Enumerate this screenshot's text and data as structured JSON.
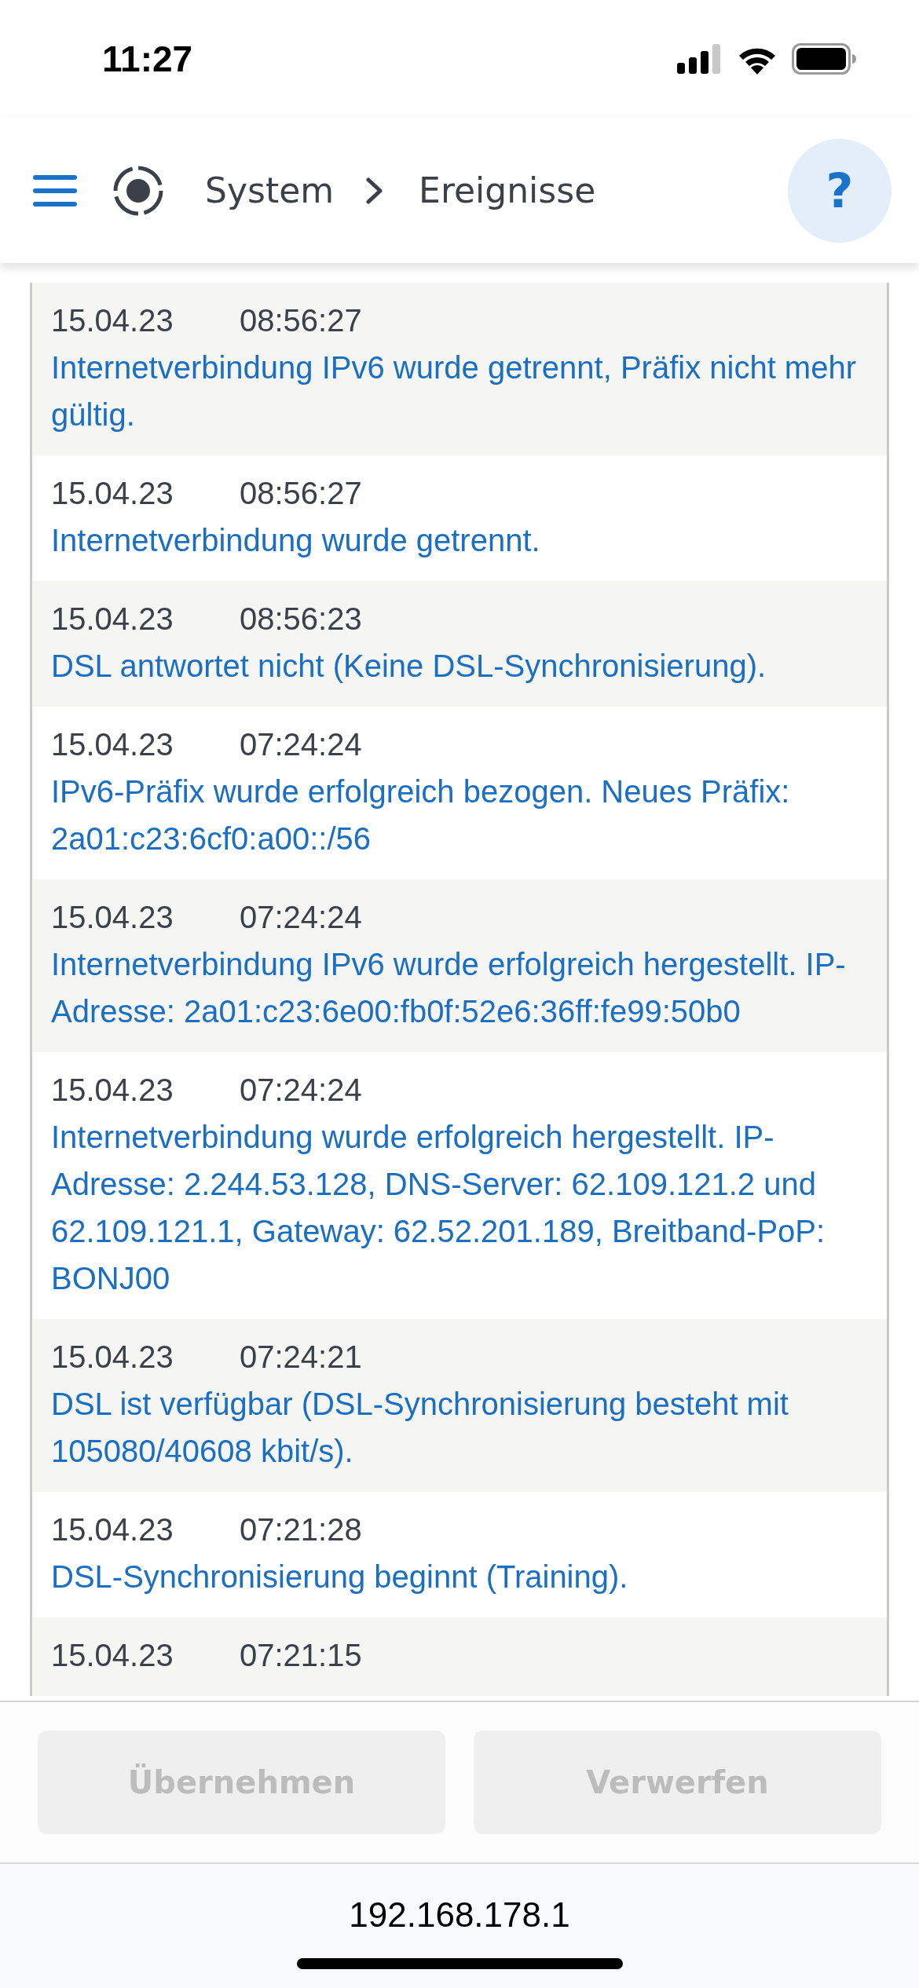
{
  "status_bar": {
    "time": "11:27"
  },
  "header": {
    "breadcrumb": [
      {
        "label": "System"
      },
      {
        "label": "Ereignisse"
      }
    ],
    "help": "?"
  },
  "events": [
    {
      "date": "15.04.23",
      "time": "08:56:27",
      "message": "Internetverbindung IPv6 wurde getrennt, Präfix nicht mehr gültig."
    },
    {
      "date": "15.04.23",
      "time": "08:56:27",
      "message": "Internetverbindung wurde getrennt."
    },
    {
      "date": "15.04.23",
      "time": "08:56:23",
      "message": "DSL antwortet nicht (Keine DSL-Synchronisierung)."
    },
    {
      "date": "15.04.23",
      "time": "07:24:24",
      "message": "IPv6-Präfix wurde erfolgreich bezogen. Neues Präfix: 2a01:c23:6cf0:a00::/56"
    },
    {
      "date": "15.04.23",
      "time": "07:24:24",
      "message": "Internetverbindung IPv6 wurde erfolgreich hergestellt. IP-Adresse: 2a01:c23:6e00:fb0f:52e6:36ff:fe99:50b0"
    },
    {
      "date": "15.04.23",
      "time": "07:24:24",
      "message": "Internetverbindung wurde erfolgreich hergestellt. IP-Adresse: 2.244.53.128, DNS-Server: 62.109.121.2 und 62.109.121.1, Gateway: 62.52.201.189, Breitband-PoP: BONJ00"
    },
    {
      "date": "15.04.23",
      "time": "07:24:21",
      "message": "DSL ist verfügbar (DSL-Synchronisierung besteht mit 105080/40608 kbit/s)."
    },
    {
      "date": "15.04.23",
      "time": "07:21:28",
      "message": "DSL-Synchronisierung beginnt (Training)."
    },
    {
      "date": "15.04.23",
      "time": "07:21:15"
    }
  ],
  "buttons": [
    {
      "label": "Übernehmen",
      "disabled": true
    },
    {
      "label": "Verwerfen",
      "disabled": true
    }
  ],
  "address_bar": {
    "url": "192.168.178.1"
  }
}
